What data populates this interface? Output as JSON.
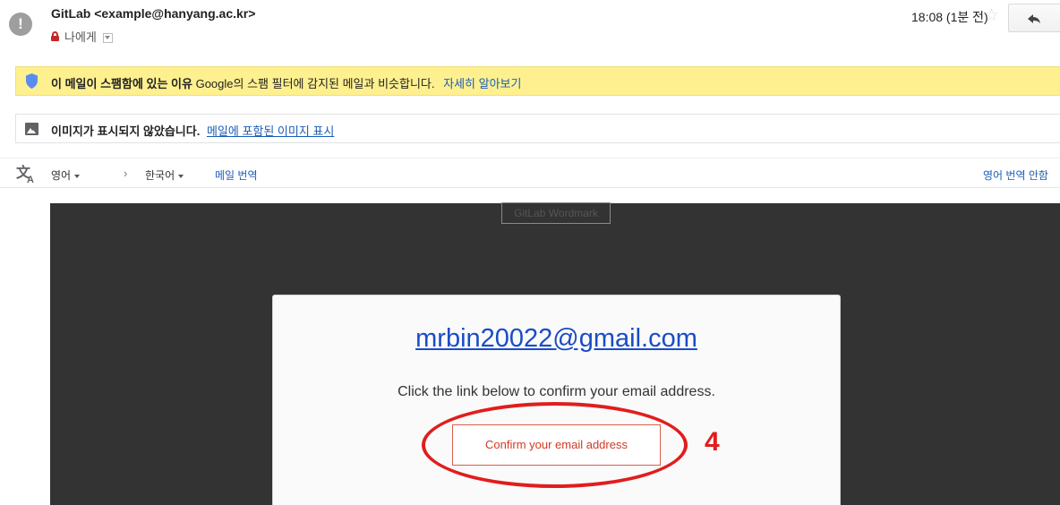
{
  "header": {
    "avatar_glyph": "!",
    "sender": "GitLab <example@hanyang.ac.kr>",
    "recipient": "나에게",
    "time": "18:08 (1분 전)"
  },
  "spam_banner": {
    "bold_text": "이 메일이 스팸함에 있는 이유",
    "text": "Google의 스팸 필터에 감지된 메일과 비슷합니다.",
    "link": "자세히 알아보기",
    "color": "#fef08f"
  },
  "images_banner": {
    "bold_text": "이미지가 표시되지 않았습니다.",
    "link": "메일에 포함된 이미지 표시"
  },
  "translate_bar": {
    "from_lang": "영어",
    "arrow": "›",
    "to_lang": "한국어",
    "translate_link": "메일 번역",
    "no_translate_link": "영어 번역 안함"
  },
  "email_body": {
    "wordmark_alt": "GitLab Wordmark",
    "email_address": "mrbin20022@gmail.com",
    "instruction": "Click the link below to confirm your email address.",
    "confirm_button": "Confirm your email address"
  },
  "annotation": {
    "number": "4",
    "color": "#e11d1d"
  }
}
